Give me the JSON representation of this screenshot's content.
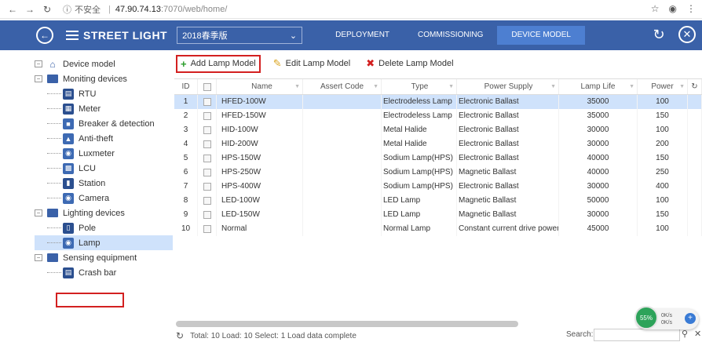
{
  "browser": {
    "insecure_label": "不安全",
    "host": "47.90.74.13",
    "path": ":7070/web/home/"
  },
  "header": {
    "title": "STREET LIGHT",
    "year_select": "2018春季版",
    "tabs": [
      {
        "label": "DEPLOYMENT"
      },
      {
        "label": "COMMISSIONING"
      },
      {
        "label": "DEVICE MODEL"
      }
    ],
    "active_tab": "DEVICE MODEL"
  },
  "sidebar": {
    "device_model": "Device model",
    "moniting_devices": "Moniting devices",
    "rtu": "RTU",
    "meter": "Meter",
    "breaker": "Breaker & detection",
    "anti_theft": "Anti-theft",
    "luxmeter": "Luxmeter",
    "lcu": "LCU",
    "station": "Station",
    "camera": "Camera",
    "lighting_devices": "Lighting devices",
    "pole": "Pole",
    "lamp": "Lamp",
    "sensing_equipment": "Sensing equipment",
    "crash_bar": "Crash bar"
  },
  "toolbar": {
    "add": "Add Lamp Model",
    "edit": "Edit Lamp Model",
    "delete": "Delete Lamp Model"
  },
  "grid": {
    "headers": {
      "id": "ID",
      "name": "Name",
      "asset": "Assert Code",
      "type": "Type",
      "power_supply": "Power Supply",
      "lamp_life": "Lamp Life",
      "power": "Power"
    },
    "rows": [
      {
        "id": "1",
        "name": "HFED-100W",
        "type": "Electrodeless Lamp",
        "ps": "Electronic Ballast",
        "life": "35000",
        "power": "100"
      },
      {
        "id": "2",
        "name": "HFED-150W",
        "type": "Electrodeless Lamp",
        "ps": "Electronic Ballast",
        "life": "35000",
        "power": "150"
      },
      {
        "id": "3",
        "name": "HID-100W",
        "type": "Metal Halide",
        "ps": "Electronic Ballast",
        "life": "30000",
        "power": "100"
      },
      {
        "id": "4",
        "name": "HID-200W",
        "type": "Metal Halide",
        "ps": "Electronic Ballast",
        "life": "30000",
        "power": "200"
      },
      {
        "id": "5",
        "name": "HPS-150W",
        "type": "Sodium Lamp(HPS)",
        "ps": "Electronic Ballast",
        "life": "40000",
        "power": "150"
      },
      {
        "id": "6",
        "name": "HPS-250W",
        "type": "Sodium Lamp(HPS)",
        "ps": "Magnetic Ballast",
        "life": "40000",
        "power": "250"
      },
      {
        "id": "7",
        "name": "HPS-400W",
        "type": "Sodium Lamp(HPS)",
        "ps": "Electronic Ballast",
        "life": "30000",
        "power": "400"
      },
      {
        "id": "8",
        "name": "LED-100W",
        "type": "LED Lamp",
        "ps": "Magnetic Ballast",
        "life": "50000",
        "power": "100"
      },
      {
        "id": "9",
        "name": "LED-150W",
        "type": "LED Lamp",
        "ps": "Magnetic Ballast",
        "life": "30000",
        "power": "150"
      },
      {
        "id": "10",
        "name": "Normal",
        "type": "Normal Lamp",
        "ps": "Constant current drive power",
        "life": "45000",
        "power": "100"
      }
    ]
  },
  "footer": {
    "status": "Total: 10  Load: 10  Select: 1  Load data complete",
    "search_label": "Search:"
  },
  "widget": {
    "percent": "55%",
    "up": "0K/s",
    "down": "0K/s"
  }
}
